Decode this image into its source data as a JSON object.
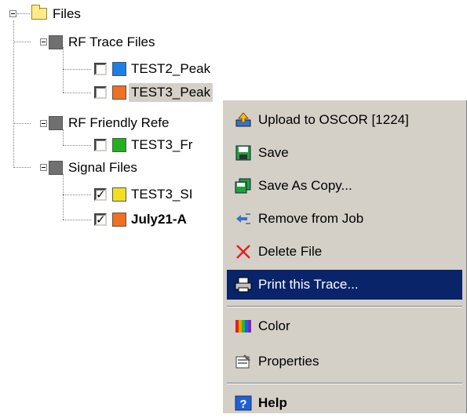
{
  "tree": {
    "root": {
      "label": "Files"
    },
    "groups": [
      {
        "label": "RF Trace Files",
        "items": [
          {
            "label": "TEST2_Peak",
            "checked": false,
            "color": "#1a7fe6"
          },
          {
            "label": "TEST3_Peak",
            "checked": false,
            "color": "#f07020",
            "selected": true
          }
        ]
      },
      {
        "label": "RF Friendly Refe",
        "items": [
          {
            "label": "TEST3_Fr",
            "checked": false,
            "color": "#20b020"
          }
        ]
      },
      {
        "label": "Signal Files",
        "items": [
          {
            "label": "TEST3_SI",
            "checked": true,
            "color": "#f0e020"
          },
          {
            "label": "July21-A",
            "checked": true,
            "color": "#f07020",
            "bold": true
          }
        ]
      }
    ]
  },
  "context_menu": {
    "items": [
      {
        "label": "Upload to OSCOR [1224]",
        "icon": "upload-icon"
      },
      {
        "label": "Save",
        "icon": "save-icon"
      },
      {
        "label": "Save As Copy...",
        "icon": "save-copy-icon"
      },
      {
        "label": "Remove from Job",
        "icon": "remove-icon"
      },
      {
        "label": "Delete File",
        "icon": "delete-icon"
      },
      {
        "label": "Print this Trace...",
        "icon": "print-icon",
        "highlighted": true
      },
      {
        "label": "Color",
        "icon": "color-icon"
      },
      {
        "label": "Properties",
        "icon": "properties-icon"
      },
      {
        "label": "Help",
        "icon": "help-icon"
      }
    ]
  },
  "colors": {
    "menu_bg": "#d4d0c8",
    "highlight": "#0a246a",
    "selection": "#d4d0c8"
  }
}
